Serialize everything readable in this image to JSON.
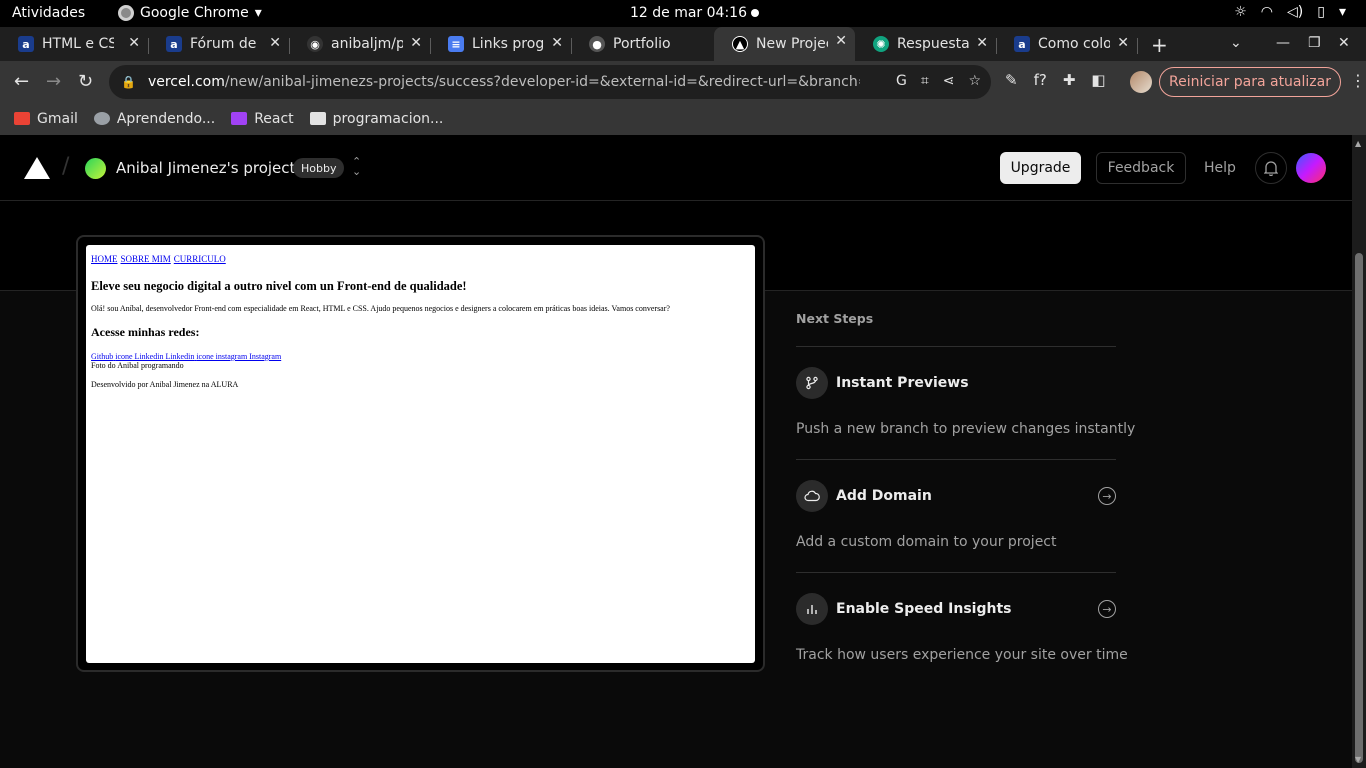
{
  "system_bar": {
    "activities": "Atividades",
    "app_name": "Google Chrome",
    "clock": "12 de mar  04:16"
  },
  "tabs": [
    {
      "title": "HTML e CSS",
      "favicon": "alura-icon",
      "color": "#1a3c8c"
    },
    {
      "title": "Fórum de Dúvidas",
      "favicon": "alura-icon",
      "color": "#1a3c8c"
    },
    {
      "title": "anibaljm/portfolio",
      "favicon": "github-icon",
      "color": "#333333"
    },
    {
      "title": "Links programação",
      "favicon": "docs-icon",
      "color": "#4a7cf0"
    },
    {
      "title": "Portfolio",
      "favicon": "globe-icon",
      "color": "#555555"
    },
    {
      "title": "New Project",
      "favicon": "vercel-icon",
      "color": "#000000",
      "active": true
    },
    {
      "title": "Respuesta",
      "favicon": "chatgpt-icon",
      "color": "#10a37f"
    },
    {
      "title": "Como colocar",
      "favicon": "alura-icon",
      "color": "#1a3c8c"
    }
  ],
  "omnibox": {
    "domain": "vercel.com",
    "path": "/new/anibal-jimenezs-projects/success?developer-id=&external-id=&redirect-url=&branch=main&de..."
  },
  "restart_button": "Reiniciar para atualizar",
  "bookmarks": [
    {
      "label": "Gmail",
      "color": "#ea4335"
    },
    {
      "label": "Aprendendo...",
      "color": "#9aa0a6"
    },
    {
      "label": "React",
      "color": "#a142f4"
    },
    {
      "label": "programacion...",
      "color": "#e3e3e3"
    }
  ],
  "vercel": {
    "team_name": "Anibal Jimenez's projects",
    "plan_badge": "Hobby",
    "upgrade": "Upgrade",
    "feedback": "Feedback",
    "help": "Help"
  },
  "preview": {
    "nav": [
      "HOME",
      "SOBRE MIM",
      "CURRICULO"
    ],
    "heading": "Eleve seu negocio digital a outro nivel com un Front-end de qualidade!",
    "intro": "Olá! sou Aníbal, desenvolvedor Front-end com especialidade em React, HTML e CSS. Ajudo pequenos negocios e designers a colocarem em práticas boas ideias. Vamos conversar?",
    "subheading": "Acesse minhas redes:",
    "links": [
      "Github",
      "icone Linkedin Linkedin",
      "icone instagram Instagram"
    ],
    "photo_alt": "Foto do Anibal programando",
    "footer": "Desenvolvido por Anibal Jimenez na ALURA"
  },
  "next_steps": {
    "title": "Next Steps",
    "items": [
      {
        "name": "Instant Previews",
        "desc": "Push a new branch to preview changes instantly",
        "icon": "git-branch-icon",
        "arrow": false
      },
      {
        "name": "Add Domain",
        "desc": "Add a custom domain to your project",
        "icon": "cloud-icon",
        "arrow": true
      },
      {
        "name": "Enable Speed Insights",
        "desc": "Track how users experience your site over time",
        "icon": "bar-chart-icon",
        "arrow": true
      }
    ]
  }
}
